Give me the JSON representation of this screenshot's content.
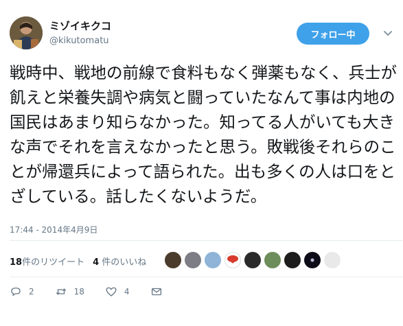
{
  "user": {
    "name": "ミゾイキクコ",
    "handle": "@kikutomatu"
  },
  "follow_button": {
    "label": "フォロー中",
    "color": "#3fa1ea"
  },
  "tweet": {
    "text": "戦時中、戦地の前線で食料もなく弾薬もなく、兵士が飢えと栄養失調や病気と闘っていたなんて事は内地の国民はあまり知らなかった。知ってる人がいても大きな声でそれを言えなかったと思う。敗戦後それらのことが帰還兵によって語られた。出も多くの人は口をとざしている。話したくないようだ。",
    "timestamp": "17:44 - 2014年4月9日"
  },
  "stats": {
    "retweets_count": "18",
    "retweets_label": "件のリツイート",
    "likes_count": "4",
    "likes_label": "件のいいね"
  },
  "liker_avatars": [
    {
      "icon": "avatar-1",
      "color": "#4a3b2c"
    },
    {
      "icon": "avatar-2",
      "color": "#7d7d86"
    },
    {
      "icon": "avatar-3",
      "color": "#8fb4d8"
    },
    {
      "icon": "avatar-4",
      "color": "#d83a2e"
    },
    {
      "icon": "avatar-5",
      "color": "#2a2a2a"
    },
    {
      "icon": "avatar-6",
      "color": "#6d8d5a"
    },
    {
      "icon": "avatar-7",
      "color": "#1d1d1d"
    },
    {
      "icon": "avatar-8",
      "color": "#0c0c18"
    },
    {
      "icon": "avatar-9",
      "color": "#e9e9e9"
    }
  ],
  "actions": {
    "reply_count": "2",
    "retweet_count": "18",
    "like_count": "4"
  }
}
